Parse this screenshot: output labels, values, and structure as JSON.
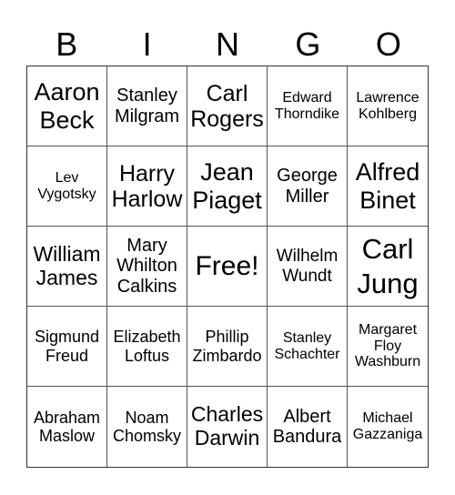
{
  "header": {
    "letters": [
      "B",
      "I",
      "N",
      "G",
      "O"
    ]
  },
  "cells": [
    "Aaron Beck",
    "Stanley Milgram",
    "Carl Rogers",
    "Edward Thorndike",
    "Lawrence Kohlberg",
    "Lev Vygotsky",
    "Harry Harlow",
    "Jean Piaget",
    "George Miller",
    "Alfred Binet",
    "William James",
    "Mary Whilton Calkins",
    "Free!",
    "Wilhelm Wundt",
    "Carl Jung",
    "Sigmund Freud",
    "Elizabeth Loftus",
    "Phillip Zimbardo",
    "Stanley Schachter",
    "Margaret Floy Washburn",
    "Abraham Maslow",
    "Noam Chomsky",
    "Charles Darwin",
    "Albert Bandura",
    "Michael Gazzaniga"
  ]
}
